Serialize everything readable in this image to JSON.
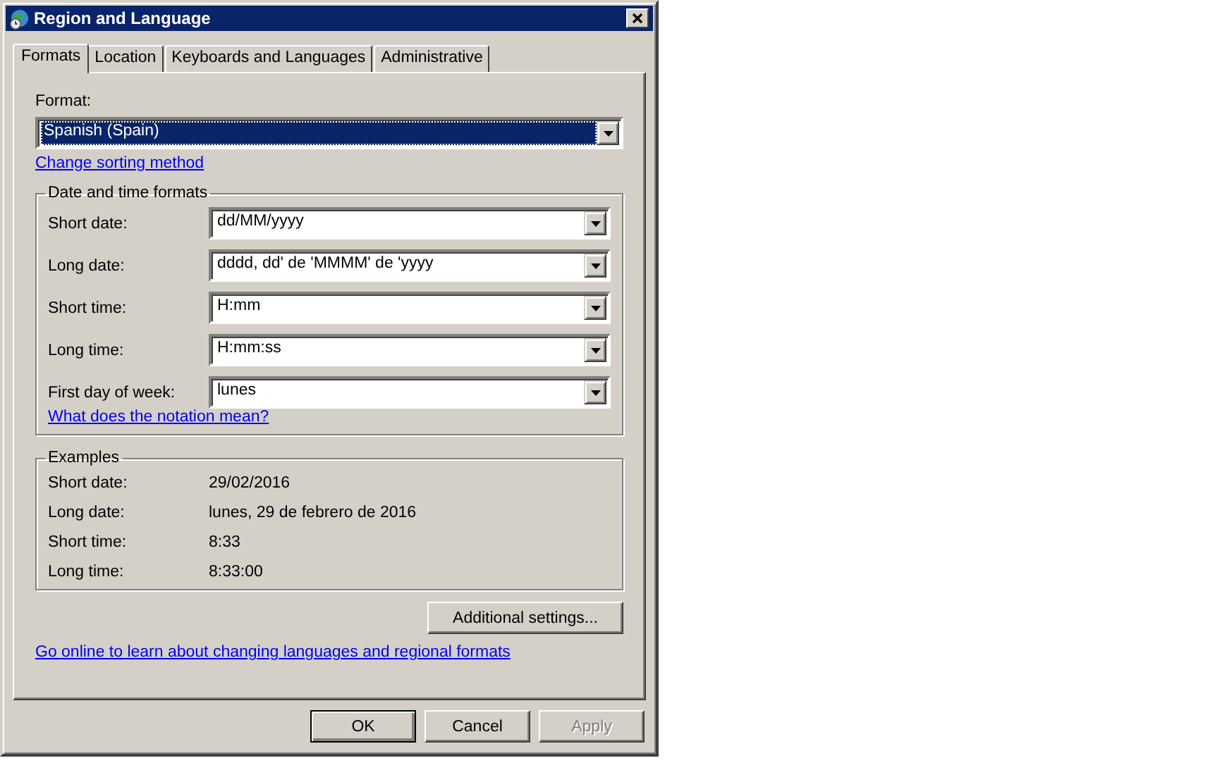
{
  "window": {
    "title": "Region and Language"
  },
  "tabs": [
    {
      "label": "Formats",
      "selected": true
    },
    {
      "label": "Location",
      "selected": false
    },
    {
      "label": "Keyboards and Languages",
      "selected": false
    },
    {
      "label": "Administrative",
      "selected": false
    }
  ],
  "format": {
    "label": "Format:",
    "value": "Spanish (Spain)",
    "focused": true
  },
  "sorting_link": "Change sorting method",
  "date_time_formats": {
    "title": "Date and time formats",
    "fields": [
      {
        "label": "Short date:",
        "value": "dd/MM/yyyy"
      },
      {
        "label": "Long date:",
        "value": "dddd, dd' de 'MMMM' de 'yyyy"
      },
      {
        "label": "Short time:",
        "value": "H:mm"
      },
      {
        "label": "Long time:",
        "value": "H:mm:ss"
      },
      {
        "label": "First day of week:",
        "value": "lunes"
      }
    ],
    "link": "What does the notation mean?"
  },
  "examples": {
    "title": "Examples",
    "rows": [
      {
        "label": "Short date:",
        "value": "29/02/2016"
      },
      {
        "label": "Long date:",
        "value": "lunes, 29 de febrero de 2016"
      },
      {
        "label": "Short time:",
        "value": "8:33"
      },
      {
        "label": "Long time:",
        "value": "8:33:00"
      }
    ]
  },
  "additional_settings_button": "Additional settings...",
  "online_link": "Go online to learn about changing languages and regional formats",
  "buttons": [
    {
      "label": "OK",
      "default": true,
      "disabled": false
    },
    {
      "label": "Cancel",
      "default": false,
      "disabled": false
    },
    {
      "label": "Apply",
      "default": false,
      "disabled": true
    }
  ]
}
